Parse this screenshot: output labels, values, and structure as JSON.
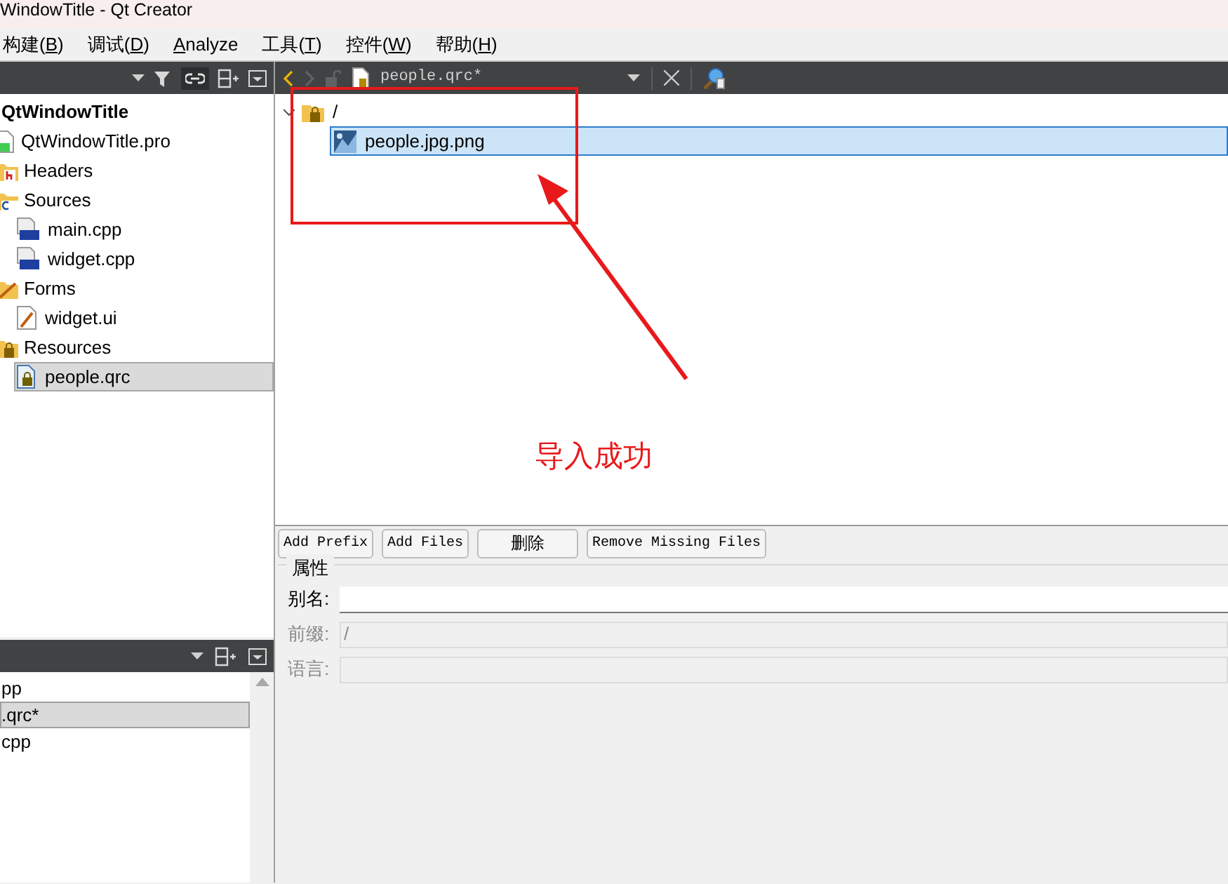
{
  "window": {
    "title": "WindowTitle - Qt Creator"
  },
  "menu": [
    {
      "before": "构建(",
      "key": "B",
      "after": ")"
    },
    {
      "before": "调试(",
      "key": "D",
      "after": ")"
    },
    {
      "key": "A",
      "after": "nalyze"
    },
    {
      "before": "工具(",
      "key": "T",
      "after": ")"
    },
    {
      "before": "控件(",
      "key": "W",
      "after": ")"
    },
    {
      "before": "帮助(",
      "key": "H",
      "after": ")"
    }
  ],
  "project_tree": {
    "root": {
      "label": "QtWindowTitle",
      "children": [
        {
          "label": "QtWindowTitle.pro",
          "kind": "pro",
          "selected": false
        },
        {
          "label": "Headers",
          "kind": "headers",
          "selected": false
        },
        {
          "label": "Sources",
          "kind": "sources",
          "selected": false,
          "children": [
            {
              "label": "main.cpp",
              "kind": "cpp",
              "selected": false
            },
            {
              "label": "widget.cpp",
              "kind": "cpp",
              "selected": false
            }
          ]
        },
        {
          "label": "Forms",
          "kind": "forms",
          "selected": false,
          "children": [
            {
              "label": "widget.ui",
              "kind": "ui",
              "selected": false
            }
          ]
        },
        {
          "label": "Resources",
          "kind": "resources",
          "selected": false,
          "children": [
            {
              "label": "people.qrc",
              "kind": "qrc",
              "selected": true
            }
          ]
        }
      ]
    }
  },
  "open_documents": {
    "items": [
      {
        "label": "pp",
        "selected": false
      },
      {
        "label": ".qrc*",
        "selected": true
      },
      {
        "label": "cpp",
        "selected": false
      }
    ]
  },
  "editor": {
    "file_name": "people.qrc*",
    "tree": {
      "label": "/",
      "expanded": true,
      "selected": false,
      "children": [
        {
          "label": "people.jpg.png",
          "selected": true
        }
      ]
    },
    "buttons": [
      "Add Prefix",
      "Add Files",
      "删除",
      "Remove Missing Files"
    ],
    "properties": {
      "title": "属性",
      "fields": [
        {
          "label": "别名:",
          "disabled": false
        },
        {
          "label": "前缀:",
          "value": "/",
          "disabled": true
        },
        {
          "label": "语言:",
          "disabled": true
        }
      ]
    }
  },
  "annotation": {
    "text": "导入成功"
  }
}
